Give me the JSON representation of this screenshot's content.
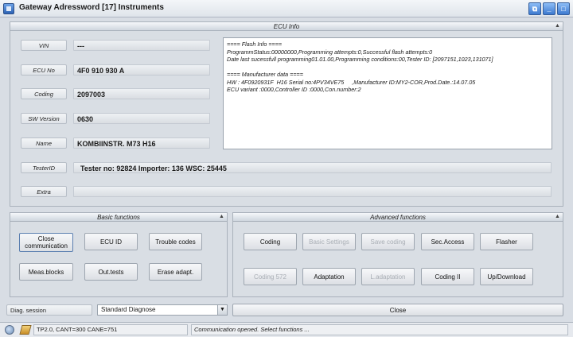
{
  "window": {
    "title": "Gateway Adressword [17] Instruments",
    "controls": {
      "restore": "⧉",
      "minimize": "_",
      "maximize": "□"
    }
  },
  "ecu_info": {
    "header": "ECU Info",
    "collapse_glyph": "▲",
    "fields": [
      {
        "label": "VIN",
        "value": "---"
      },
      {
        "label": "ECU No",
        "value": "4F0 910 930 A"
      },
      {
        "label": "Coding",
        "value": "2097003"
      },
      {
        "label": "SW Version",
        "value": "0630"
      },
      {
        "label": "Name",
        "value": "KOMBIINSTR. M73 H16"
      },
      {
        "label": "TesterID",
        "value": "Tester no: 92824 Importer: 136 WSC: 25445"
      },
      {
        "label": "Extra",
        "value": ""
      }
    ],
    "flash_info": "==== Flash Info ====\nProgrammStatus:00000000,Programming attempts:0,Successful flash attempts:0\nDate last sucessfull programming01.01.00,Programming conditions:00,Tester ID: [2097151,1023,131071]\n\n==== Manufacturer data ====\nHW : 4F0920931F  H16 Serial no:4PV34VE75     ,Manufacturer ID:MY2-COR,Prod.Date.:14.07.05\nECU variant :0000,Controller ID :0000,Con.number:2"
  },
  "basic_functions": {
    "header": "Basic functions",
    "collapse_glyph": "▲",
    "buttons": [
      "Close communication",
      "ECU ID",
      "Trouble codes",
      "Meas.blocks",
      "Out.tests",
      "Erase adapt."
    ]
  },
  "advanced_functions": {
    "header": "Advanced functions",
    "collapse_glyph": "▲",
    "buttons": [
      "Coding",
      "Basic Settings",
      "Save coding",
      "Sec.Access",
      "Flasher",
      "Coding 572",
      "Adaptation",
      "L.adaptation",
      "Coding II",
      "Up/Download"
    ]
  },
  "diag_session": {
    "label": "Diag. session",
    "selected": "Standard Diagnose",
    "arrow": "▼"
  },
  "close_button": "Close",
  "status": {
    "protocol": "TP2.0, CANT=300 CANE=751",
    "message": "Communication opened. Select functions ..."
  }
}
